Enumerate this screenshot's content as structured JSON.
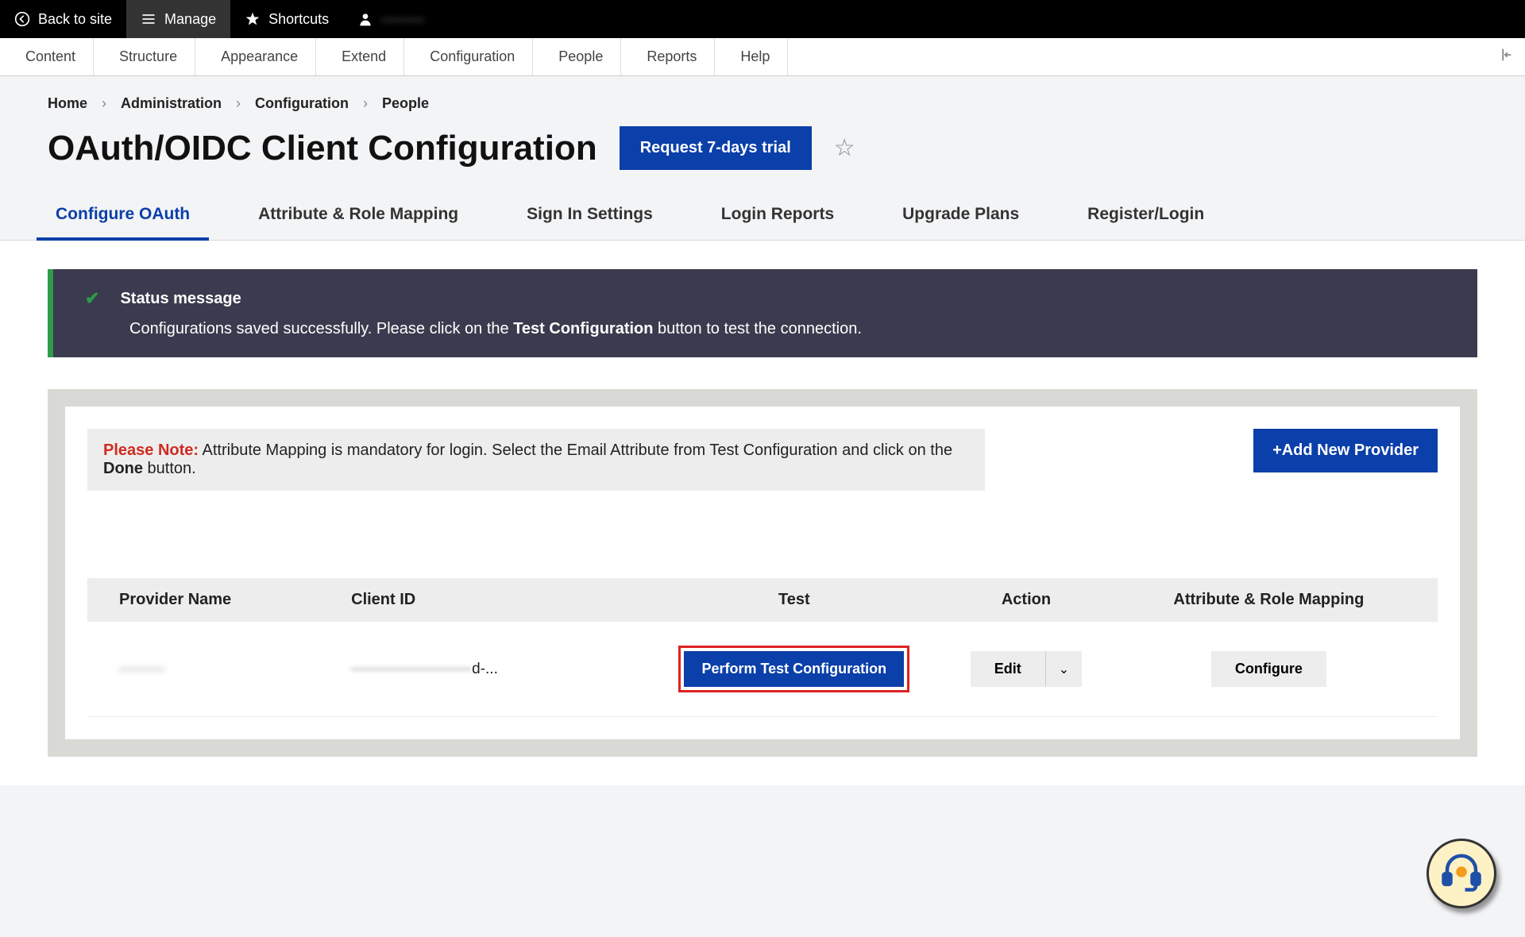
{
  "topbar": {
    "back": "Back to site",
    "manage": "Manage",
    "shortcuts": "Shortcuts",
    "user": "———"
  },
  "adminmenu": {
    "content": "Content",
    "structure": "Structure",
    "appearance": "Appearance",
    "extend": "Extend",
    "configuration": "Configuration",
    "people": "People",
    "reports": "Reports",
    "help": "Help"
  },
  "breadcrumbs": [
    "Home",
    "Administration",
    "Configuration",
    "People"
  ],
  "page_title": "OAuth/OIDC Client Configuration",
  "trial_button": "Request 7-days trial",
  "tabs": [
    "Configure OAuth",
    "Attribute & Role Mapping",
    "Sign In Settings",
    "Login Reports",
    "Upgrade Plans",
    "Register/Login"
  ],
  "status": {
    "title": "Status message",
    "body_pre": "Configurations saved successfully. Please click on the ",
    "body_bold": "Test Configuration",
    "body_post": " button to test the connection."
  },
  "note": {
    "label": "Please Note:",
    "text_pre": " Attribute Mapping is mandatory for login. Select the Email Attribute from Test Configuration and click on the ",
    "bold": "Done",
    "text_post": " button."
  },
  "add_provider": "+Add New Provider",
  "table": {
    "headers": [
      "Provider Name",
      "Client ID",
      "Test",
      "Action",
      "Attribute & Role Mapping"
    ],
    "row": {
      "provider": "———",
      "client_id": "————————d-...",
      "test": "Perform Test Configuration",
      "action": "Edit",
      "configure": "Configure"
    }
  }
}
